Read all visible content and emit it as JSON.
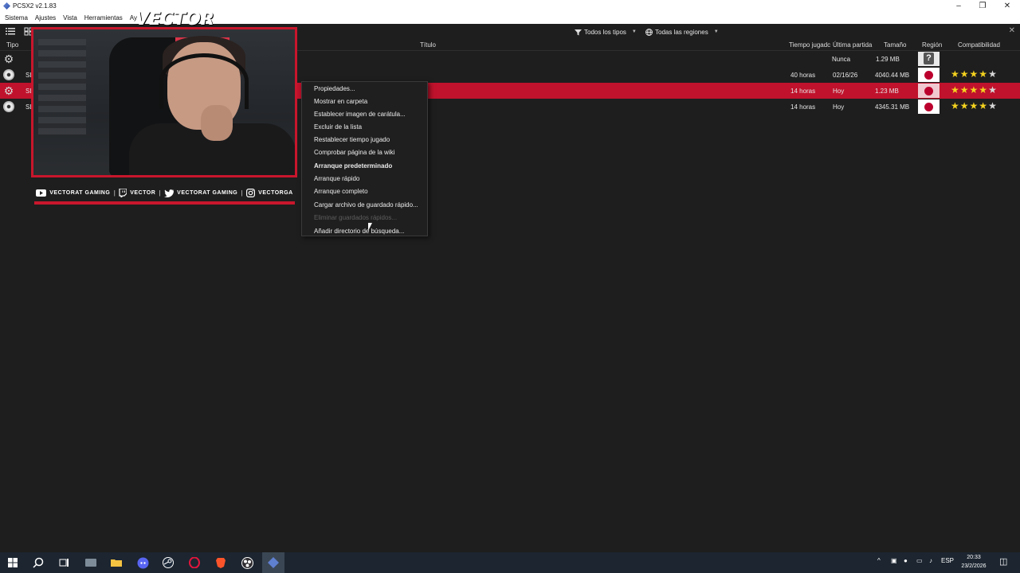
{
  "window": {
    "title": "PCSX2 v2.1.83"
  },
  "menubar": [
    "Sistema",
    "Ajustes",
    "Vista",
    "Herramientas",
    "Ay"
  ],
  "toolbar": {
    "filter_type": "Todos los tipos",
    "filter_region": "Todas las regiones"
  },
  "table": {
    "headers": {
      "type": "Tipo",
      "title": "Título",
      "playtime": "Tiempo jugadc",
      "last_played": "Última partida",
      "size": "Tamaño",
      "region": "Región",
      "compat": "Compatibilidad"
    },
    "rows": [
      {
        "type_icon": "gear-icon",
        "serial": "",
        "playtime": "",
        "last_played": "Nunca",
        "size": "1.29 MB",
        "region": "unknown",
        "stars": 0,
        "selected": false
      },
      {
        "type_icon": "disc-icon",
        "serial": "SL",
        "playtime": "40 horas",
        "last_played": "02/16/26",
        "size": "4040.44 MB",
        "region": "jp",
        "stars": 4,
        "selected": false
      },
      {
        "type_icon": "gear-icon",
        "serial": "SL",
        "playtime": "14 horas",
        "last_played": "Hoy",
        "size": "1.23 MB",
        "region": "jp",
        "stars": 4,
        "selected": true
      },
      {
        "type_icon": "disc-icon",
        "serial": "SL",
        "playtime": "14 horas",
        "last_played": "Hoy",
        "size": "4345.31 MB",
        "region": "jp",
        "stars": 4,
        "selected": false
      }
    ]
  },
  "context_menu": {
    "items": [
      {
        "label": "Propiedades...",
        "style": "normal"
      },
      {
        "label": "Mostrar en carpeta",
        "style": "normal"
      },
      {
        "label": "Establecer imagen de carátula...",
        "style": "normal"
      },
      {
        "label": "Excluir de la lista",
        "style": "normal"
      },
      {
        "label": "Restablecer tiempo jugado",
        "style": "normal"
      },
      {
        "label": "Comprobar página de la wiki",
        "style": "normal"
      },
      {
        "label": "Arranque predeterminado",
        "style": "bold"
      },
      {
        "label": "Arranque rápido",
        "style": "normal"
      },
      {
        "label": "Arranque completo",
        "style": "normal"
      },
      {
        "label": "Cargar archivo de guardado rápido...",
        "style": "normal"
      },
      {
        "label": "Eliminar guardados rápidos...",
        "style": "disabled"
      },
      {
        "label": "Añadir directorio de búsqueda...",
        "style": "normal"
      }
    ]
  },
  "overlay": {
    "brand": "VECTOR",
    "social": [
      {
        "icon": "youtube-icon",
        "label": "VECTORAT GAMING"
      },
      {
        "icon": "twitch-icon",
        "label": "VECTOR"
      },
      {
        "icon": "twitter-icon",
        "label": "VECTORAT GAMING"
      },
      {
        "icon": "instagram-icon",
        "label": "VECTORGA"
      }
    ]
  },
  "taskbar": {
    "language": "ESP",
    "time": "20:33",
    "date": "23/2/2026"
  },
  "colors": {
    "accent": "#c0122c",
    "star": "#f4d21f"
  }
}
